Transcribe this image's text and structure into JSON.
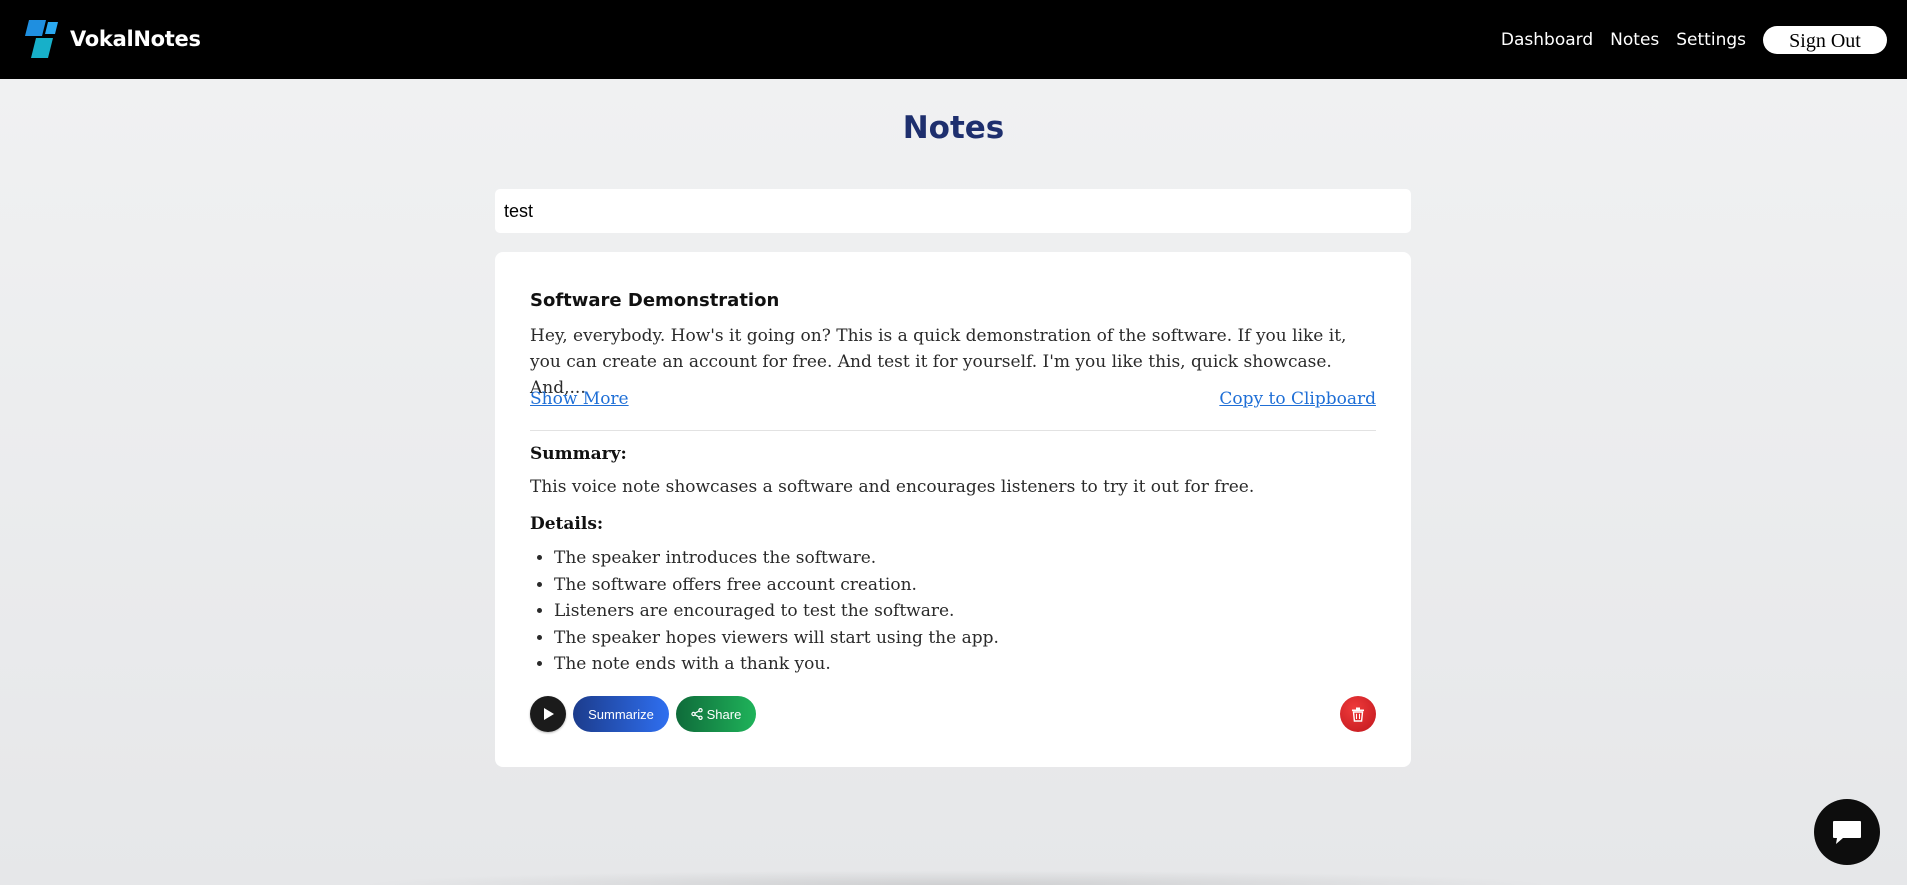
{
  "header": {
    "brand_name": "VokalNotes",
    "nav": [
      "Dashboard",
      "Notes",
      "Settings"
    ],
    "sign_out_label": "Sign Out"
  },
  "page": {
    "title": "Notes"
  },
  "search": {
    "value": "test"
  },
  "note": {
    "title": "Software Demonstration",
    "body": "Hey, everybody. How's it going on? This is a quick demonstration of the software. If you like it, you can create an account for free. And test it for yourself. I'm you like this, quick showcase. And,...",
    "show_more_label": "Show More",
    "copy_label": "Copy to Clipboard",
    "summary_label": "Summary:",
    "summary_text": "This voice note showcases a software and encourages listeners to try it out for free.",
    "details_label": "Details:",
    "details": [
      "The speaker introduces the software.",
      "The software offers free account creation.",
      "Listeners are encouraged to test the software.",
      "The speaker hopes viewers will start using the app.",
      "The note ends with a thank you."
    ],
    "actions": {
      "summarize_label": "Summarize",
      "share_label": "Share"
    }
  },
  "icons": {
    "brand": "logo-icon",
    "play": "play-icon",
    "share": "share-icon",
    "delete": "trash-icon",
    "chat": "chat-bubble-icon"
  },
  "colors": {
    "topbar": "#000000",
    "title": "#1e2f6e",
    "link": "#1f6fd6",
    "summarize": "#2f6ff0",
    "share": "#1fb35a",
    "delete": "#d0202a"
  }
}
